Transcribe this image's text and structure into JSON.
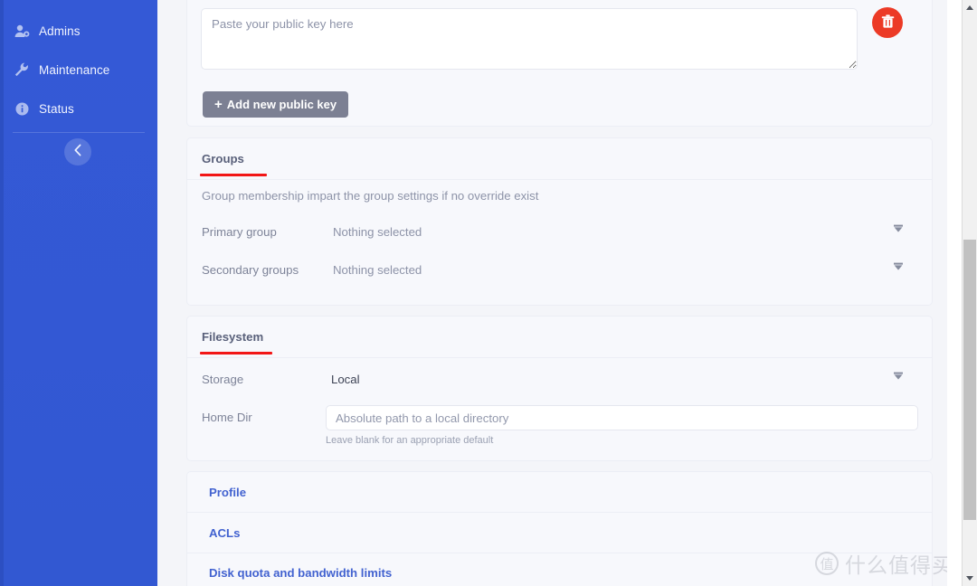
{
  "sidebar": {
    "items": [
      {
        "label": "Admins",
        "icon": "user-gear-icon"
      },
      {
        "label": "Maintenance",
        "icon": "wrench-icon"
      },
      {
        "label": "Status",
        "icon": "info-circle-icon"
      }
    ],
    "collapse_icon": "chevron-left-icon",
    "bg_color": "#3358d4"
  },
  "public_key_card": {
    "textarea_placeholder": "Paste your public key here",
    "textarea_value": "",
    "add_button_label": "Add new public key",
    "add_button_icon": "plus-icon",
    "delete_button_icon": "trash-icon",
    "delete_button_color": "#ec3a26"
  },
  "groups_card": {
    "title": "Groups",
    "underline_color": "#f21616",
    "description": "Group membership impart the group settings if no override exist",
    "rows": [
      {
        "label": "Primary group",
        "value": "Nothing selected",
        "icon": "chevron-down-icon"
      },
      {
        "label": "Secondary groups",
        "value": "Nothing selected",
        "icon": "chevron-down-icon"
      }
    ]
  },
  "filesystem_card": {
    "title": "Filesystem",
    "underline_color": "#f21616",
    "storage_label": "Storage",
    "storage_value": "Local",
    "storage_icon": "chevron-down-icon",
    "home_dir_label": "Home Dir",
    "home_dir_placeholder": "Absolute path to a local directory",
    "home_dir_value": "",
    "home_dir_helper": "Leave blank for an appropriate default"
  },
  "accordions": [
    {
      "label": "Profile"
    },
    {
      "label": "ACLs"
    },
    {
      "label": "Disk quota and bandwidth limits"
    }
  ],
  "scrollbar": {
    "up_icon": "triangle-up-icon",
    "down_icon": "triangle-down-icon"
  },
  "watermark": {
    "mark": "值",
    "text": "什么值得买"
  }
}
